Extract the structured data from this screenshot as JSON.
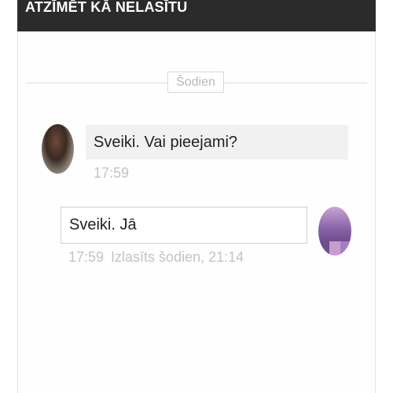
{
  "header": {
    "mark_unread_label": "ATZĪMĒT KĀ NELASĪTU"
  },
  "divider": {
    "label": "Šodien"
  },
  "messages": [
    {
      "direction": "incoming",
      "text": "Sveiki. Vai pieejami?",
      "time": "17:59"
    },
    {
      "direction": "outgoing",
      "text": "Sveiki. Jā",
      "time": "17:59",
      "status": "Izlasīts šodien, 21:14"
    }
  ],
  "colors": {
    "header_bg": "#2b2b2b",
    "incoming_bubble": "#f1f1f1",
    "meta_text": "#c4c4c4"
  }
}
